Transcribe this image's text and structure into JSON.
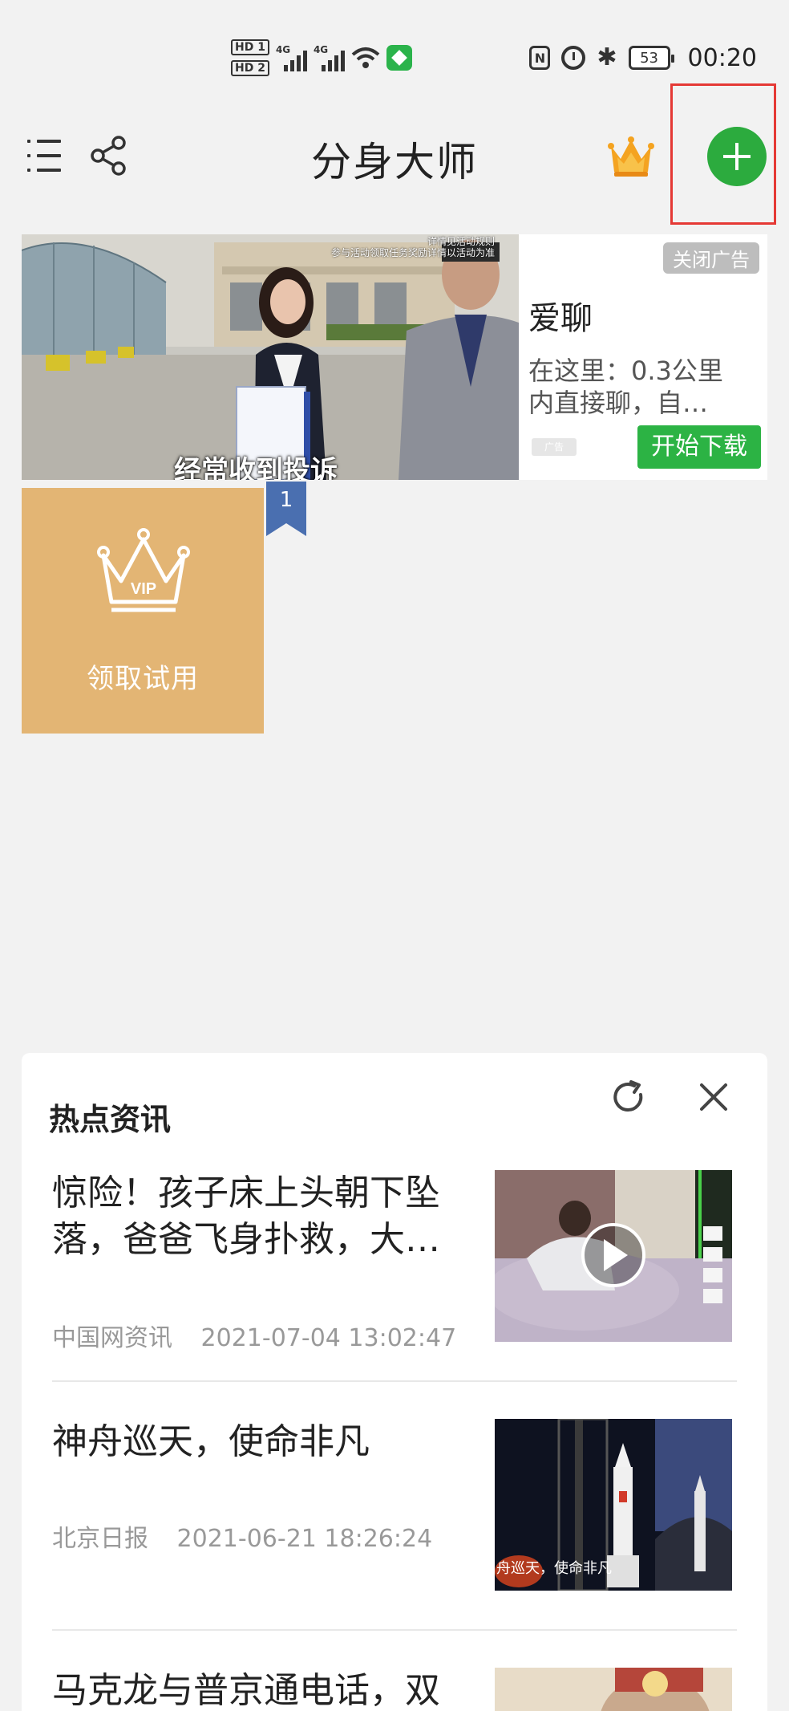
{
  "status_bar": {
    "hd1": "HD 1",
    "hd2": "HD 2",
    "net1": "4G",
    "net2": "4G",
    "nfc": "N",
    "bluetooth": "✱",
    "battery": "53",
    "time": "00:20"
  },
  "header": {
    "title": "分身大师",
    "icons": [
      "menu-icon",
      "share-icon",
      "vip-crown-icon",
      "add-icon"
    ]
  },
  "ad": {
    "close_label": "关闭广告",
    "app_name": "爱聊",
    "description": "在这里：0.3公里内直接聊，自…",
    "ad_tag": "广告",
    "download_label": "开始下载",
    "image_caption": "经常收到投诉",
    "image_overlay_line1": "详情见活动规则",
    "image_overlay_line2": "参与活动领取任务奖励详情以活动为准"
  },
  "vip": {
    "crown_text": "VIP",
    "label": "领取试用",
    "slot_number": "1"
  },
  "news": {
    "title": "热点资讯",
    "items": [
      {
        "headline": "惊险！孩子床上头朝下坠落，爸爸飞身扑救，大…",
        "source": "中国网资讯",
        "time": "2021-07-04 13:02:47",
        "has_video": true
      },
      {
        "headline": "神舟巡天，使命非凡",
        "source": "北京日报",
        "time": "2021-06-21 18:26:24",
        "thumb_caption": "舟巡天，使命非凡"
      },
      {
        "headline": "马克龙与普京通电话，双"
      }
    ]
  },
  "colors": {
    "accent_green": "#2cab3e",
    "vip_gold": "#e3b574",
    "highlight_red": "#e53935",
    "bookmark_blue": "#4a6fb0"
  }
}
